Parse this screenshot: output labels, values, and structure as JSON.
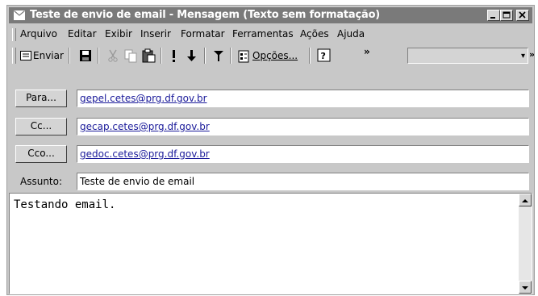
{
  "window": {
    "title": "Teste de envio de email - Mensagem (Texto sem formatação)"
  },
  "menu": [
    "Arquivo",
    "Editar",
    "Exibir",
    "Inserir",
    "Formatar",
    "Ferramentas",
    "Ações",
    "Ajuda"
  ],
  "toolbar": {
    "send_label": "Enviar",
    "options_label": "Opções...",
    "chevron": "»",
    "combo_arrow": "▾",
    "icons": [
      "send-icon",
      "save-icon",
      "cut-icon",
      "copy-icon",
      "paste-icon",
      "importance-high-icon",
      "importance-low-icon",
      "flag-icon",
      "options-icon",
      "help-icon"
    ]
  },
  "header": {
    "to_label": "Para...",
    "to_value": "gepel.cetes@prg.df.gov.br",
    "cc_label": "Cc...",
    "cc_value": "gecap.cetes@prg.df.gov.br",
    "bcc_label": "Cco...",
    "bcc_value": "gedoc.cetes@prg.df.gov.br",
    "subject_label": "Assunto:",
    "subject_value": "Teste de envio de email"
  },
  "body": {
    "text": "Testando email."
  }
}
